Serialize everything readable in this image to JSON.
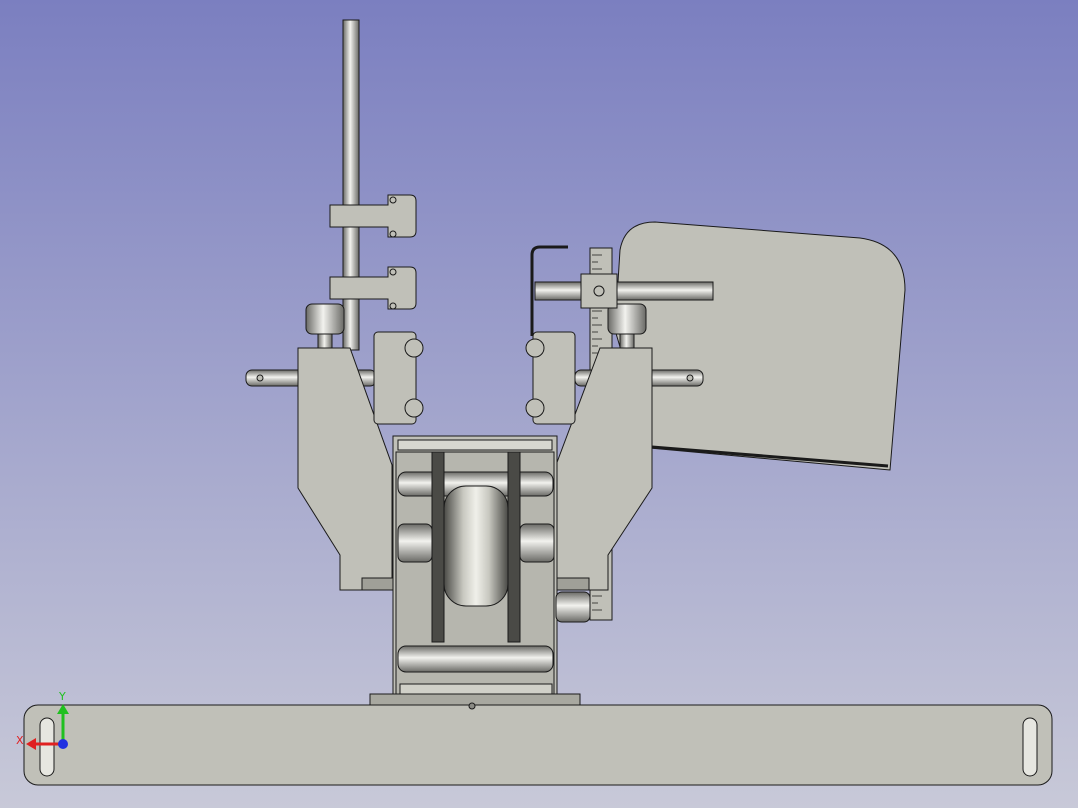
{
  "viewport": {
    "background_top": "#7b7fc0",
    "background_bottom": "#c8c9d8",
    "part_fill": "#c0c0b8",
    "part_stroke": "#1a1a1a",
    "shade_dark": "#6a6a66",
    "shade_light": "#f2f2ee"
  },
  "axis_triad": {
    "x_label": "X",
    "y_label": "Y",
    "x_color": "#e02020",
    "y_color": "#20c020",
    "z_color": "#2030e0"
  }
}
